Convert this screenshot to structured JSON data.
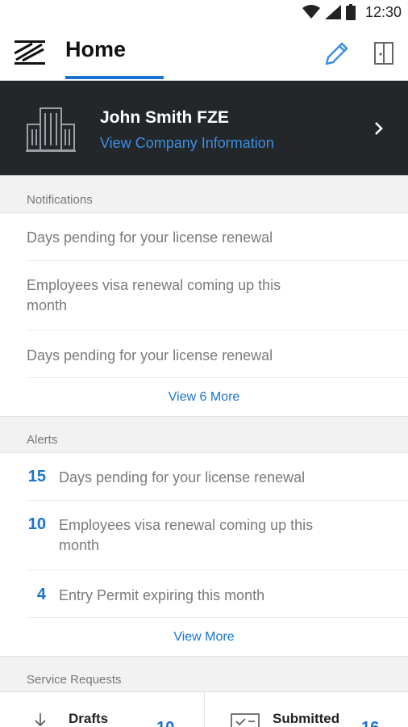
{
  "status_bar": {
    "time": "12:30"
  },
  "app_bar": {
    "title": "Home"
  },
  "company": {
    "name": "John Smith FZE",
    "link": "View Company Information"
  },
  "notifications": {
    "header": "Notifications",
    "items": [
      "Days pending for your license renewal",
      "Employees visa renewal coming up this month",
      "Days pending for your license renewal"
    ],
    "more_link": "View 6 More"
  },
  "alerts": {
    "header": "Alerts",
    "items": [
      {
        "count": "15",
        "text": "Days pending for your license renewal"
      },
      {
        "count": "10",
        "text": "Employees visa renewal coming up this month"
      },
      {
        "count": "4",
        "text": "Entry Permit expiring this month"
      }
    ],
    "more_link": "View More"
  },
  "service_requests": {
    "header": "Service Requests",
    "cards": [
      {
        "label": "Drafts",
        "count": "10",
        "icon": "download-icon"
      },
      {
        "label": "Submitted",
        "count": "16",
        "icon": "submitted-icon"
      }
    ]
  },
  "colors": {
    "accent": "#1a73d0",
    "banner": "#24272a",
    "link": "#3b8fe3"
  }
}
